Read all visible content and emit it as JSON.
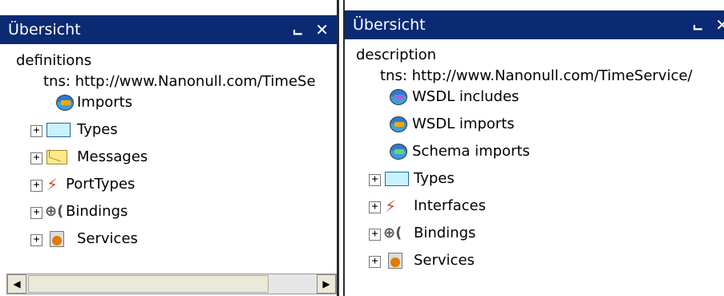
{
  "left_panel": {
    "title": "Übersicht",
    "pin_icon": "pin-icon",
    "close_icon": "close-icon",
    "root": "definitions",
    "tns": "tns:  http://www.Nanonull.com/TimeSe",
    "items": [
      {
        "label": "Imports",
        "icon": "imports-globe-icon"
      },
      {
        "label": "Types",
        "icon": "types-box-icon"
      },
      {
        "label": "Messages",
        "icon": "envelope-icon"
      },
      {
        "label": "PortTypes",
        "icon": "porttypes-icon"
      },
      {
        "label": "Bindings",
        "icon": "bindings-icon"
      },
      {
        "label": "Services",
        "icon": "services-icon"
      }
    ],
    "scroll_left": "◀",
    "scroll_right": "▶"
  },
  "right_panel": {
    "title": "Übersicht",
    "pin_icon": "pin-icon",
    "close_icon": "close-icon",
    "root": "description",
    "tns": "tns:  http://www.Nanonull.com/TimeService/",
    "items": [
      {
        "label": "WSDL includes",
        "icon": "wsdl-includes-icon"
      },
      {
        "label": "WSDL imports",
        "icon": "wsdl-imports-icon"
      },
      {
        "label": "Schema imports",
        "icon": "schema-imports-icon"
      },
      {
        "label": "Types",
        "icon": "types-box-icon"
      },
      {
        "label": "Interfaces",
        "icon": "interfaces-icon"
      },
      {
        "label": "Bindings",
        "icon": "bindings-icon"
      },
      {
        "label": "Services",
        "icon": "services-icon"
      }
    ]
  },
  "glyphs": {
    "pin": "ᵼ",
    "close": "✕",
    "expand": "+",
    "porttype": "⚡",
    "binding": "⊕("
  }
}
